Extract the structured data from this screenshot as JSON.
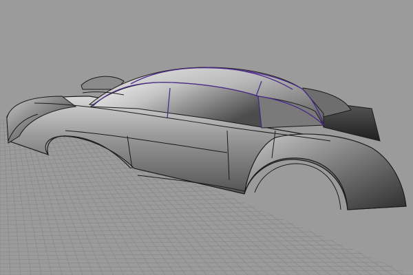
{
  "viewport": {
    "background_color": "#9b9b9b",
    "grid_color": "#858585",
    "surface_color": "#8a8a8a",
    "isocurve_color": "#4a2a8a",
    "edge_color": "#1a1a1a"
  },
  "model": {
    "icon": "car-body-surface-model"
  }
}
